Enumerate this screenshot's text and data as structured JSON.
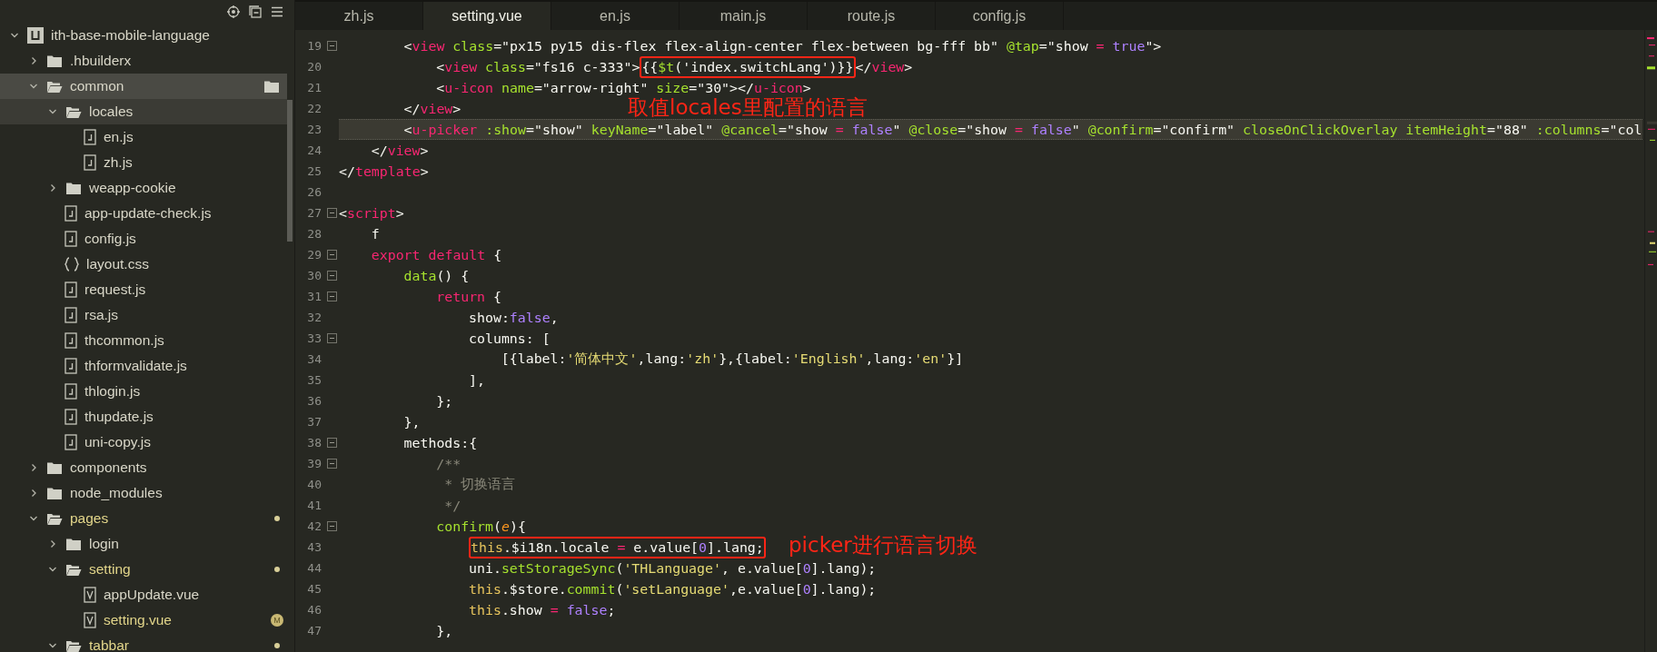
{
  "explorer": {
    "tree": [
      {
        "label": "ith-base-mobile-language",
        "kind": "project",
        "expanded": true,
        "selected": false,
        "hovered": false,
        "modified": false,
        "children": [
          {
            "label": ".hbuilderx",
            "kind": "folder",
            "expanded": false,
            "selected": false,
            "hovered": false,
            "modified": false
          },
          {
            "label": "common",
            "kind": "folder",
            "expanded": true,
            "selected": false,
            "hovered": true,
            "modified": false,
            "children": [
              {
                "label": "locales",
                "kind": "folder",
                "expanded": true,
                "selected": true,
                "hovered": false,
                "modified": false,
                "children": [
                  {
                    "label": "en.js",
                    "kind": "file",
                    "selected": false,
                    "hovered": false,
                    "modified": false
                  },
                  {
                    "label": "zh.js",
                    "kind": "file",
                    "selected": false,
                    "hovered": false,
                    "modified": false
                  }
                ]
              },
              {
                "label": "weapp-cookie",
                "kind": "folder",
                "expanded": false,
                "selected": false,
                "hovered": false,
                "modified": false
              },
              {
                "label": "app-update-check.js",
                "kind": "file",
                "selected": false,
                "hovered": false,
                "modified": false
              },
              {
                "label": "config.js",
                "kind": "file",
                "selected": false,
                "hovered": false,
                "modified": false
              },
              {
                "label": "layout.css",
                "kind": "css",
                "selected": false,
                "hovered": false,
                "modified": false
              },
              {
                "label": "request.js",
                "kind": "file",
                "selected": false,
                "hovered": false,
                "modified": false
              },
              {
                "label": "rsa.js",
                "kind": "file",
                "selected": false,
                "hovered": false,
                "modified": false
              },
              {
                "label": "thcommon.js",
                "kind": "file",
                "selected": false,
                "hovered": false,
                "modified": false
              },
              {
                "label": "thformvalidate.js",
                "kind": "file",
                "selected": false,
                "hovered": false,
                "modified": false
              },
              {
                "label": "thlogin.js",
                "kind": "file",
                "selected": false,
                "hovered": false,
                "modified": false
              },
              {
                "label": "thupdate.js",
                "kind": "file",
                "selected": false,
                "hovered": false,
                "modified": false
              },
              {
                "label": "uni-copy.js",
                "kind": "file",
                "selected": false,
                "hovered": false,
                "modified": false
              }
            ]
          },
          {
            "label": "components",
            "kind": "folder",
            "expanded": false,
            "selected": false,
            "hovered": false,
            "modified": false
          },
          {
            "label": "node_modules",
            "kind": "folder",
            "expanded": false,
            "selected": false,
            "hovered": false,
            "modified": false
          },
          {
            "label": "pages",
            "kind": "folder",
            "expanded": true,
            "selected": false,
            "hovered": false,
            "modified": true,
            "children": [
              {
                "label": "login",
                "kind": "folder",
                "expanded": false,
                "selected": false,
                "hovered": false,
                "modified": false
              },
              {
                "label": "setting",
                "kind": "folder",
                "expanded": true,
                "selected": false,
                "hovered": false,
                "modified": true,
                "children": [
                  {
                    "label": "appUpdate.vue",
                    "kind": "vue",
                    "selected": false,
                    "hovered": false,
                    "modified": false
                  },
                  {
                    "label": "setting.vue",
                    "kind": "vue",
                    "selected": false,
                    "hovered": false,
                    "modified": true,
                    "badge": "M"
                  }
                ]
              },
              {
                "label": "tabbar",
                "kind": "folder",
                "expanded": true,
                "selected": false,
                "hovered": false,
                "modified": true
              }
            ]
          }
        ]
      }
    ]
  },
  "tabs": [
    {
      "label": "zh.js",
      "selected": false
    },
    {
      "label": "setting.vue",
      "selected": true
    },
    {
      "label": "en.js",
      "selected": false
    },
    {
      "label": "main.js",
      "selected": false
    },
    {
      "label": "route.js",
      "selected": false
    },
    {
      "label": "config.js",
      "selected": false
    }
  ],
  "editor": {
    "lines": [
      {
        "number": "19",
        "fold": true,
        "current": false,
        "tokens": [
          {
            "kind": "plain",
            "text": "        <"
          },
          {
            "kind": "tag",
            "text": "view "
          },
          {
            "kind": "attr",
            "text": "class"
          },
          {
            "kind": "plain",
            "text": "=\"px15 py15 dis-flex flex-align-center flex-between bg-fff bb\" "
          },
          {
            "kind": "attr",
            "text": "@tap"
          },
          {
            "kind": "plain",
            "text": "=\"show "
          },
          {
            "kind": "op",
            "text": "="
          },
          {
            "kind": "num",
            "text": " true"
          },
          {
            "kind": "plain",
            "text": "\">"
          }
        ]
      },
      {
        "number": "20",
        "fold": false,
        "current": false,
        "tokens": [
          {
            "kind": "plain",
            "text": "            <"
          },
          {
            "kind": "tag",
            "text": "view "
          },
          {
            "kind": "attr",
            "text": "class"
          },
          {
            "kind": "plain",
            "text": "=\"fs16 c-333\">"
          },
          {
            "kind": "box",
            "tokens": [
              {
                "kind": "plain",
                "text": "{{"
              },
              {
                "kind": "fn",
                "text": "$t"
              },
              {
                "kind": "plain",
                "text": "('index.switchLang')}}"
              }
            ]
          },
          {
            "kind": "plain",
            "text": "</"
          },
          {
            "kind": "tag",
            "text": "view"
          },
          {
            "kind": "plain",
            "text": ">"
          }
        ]
      },
      {
        "number": "21",
        "fold": false,
        "current": false,
        "tokens": [
          {
            "kind": "plain",
            "text": "            <"
          },
          {
            "kind": "tag",
            "text": "u-icon "
          },
          {
            "kind": "attr",
            "text": "name"
          },
          {
            "kind": "plain",
            "text": "=\"arrow-right\" "
          },
          {
            "kind": "attr",
            "text": "size"
          },
          {
            "kind": "plain",
            "text": "=\"30\"></"
          },
          {
            "kind": "tag",
            "text": "u-icon"
          },
          {
            "kind": "plain",
            "text": ">"
          }
        ]
      },
      {
        "number": "22",
        "fold": false,
        "current": false,
        "tokens": [
          {
            "kind": "plain",
            "text": "        </"
          },
          {
            "kind": "tag",
            "text": "view"
          },
          {
            "kind": "plain",
            "text": ">"
          }
        ]
      },
      {
        "number": "23",
        "fold": false,
        "current": true,
        "tokens": [
          {
            "kind": "plain",
            "text": "        <"
          },
          {
            "kind": "tag",
            "text": "u-picker "
          },
          {
            "kind": "attr",
            "text": ":show"
          },
          {
            "kind": "plain",
            "text": "=\"show\" "
          },
          {
            "kind": "attr",
            "text": "keyName"
          },
          {
            "kind": "plain",
            "text": "=\"label\" "
          },
          {
            "kind": "attr",
            "text": "@cancel"
          },
          {
            "kind": "plain",
            "text": "=\"show "
          },
          {
            "kind": "op",
            "text": "="
          },
          {
            "kind": "num",
            "text": " false"
          },
          {
            "kind": "plain",
            "text": "\" "
          },
          {
            "kind": "attr",
            "text": "@close"
          },
          {
            "kind": "plain",
            "text": "=\"show "
          },
          {
            "kind": "op",
            "text": "="
          },
          {
            "kind": "num",
            "text": " false"
          },
          {
            "kind": "plain",
            "text": "\" "
          },
          {
            "kind": "attr",
            "text": "@confirm"
          },
          {
            "kind": "plain",
            "text": "=\"confirm\" "
          },
          {
            "kind": "attr",
            "text": "closeOnClickOverlay itemHeight"
          },
          {
            "kind": "plain",
            "text": "=\"88\" "
          },
          {
            "kind": "attr",
            "text": ":columns"
          },
          {
            "kind": "plain",
            "text": "=\"col"
          }
        ]
      },
      {
        "number": "24",
        "fold": false,
        "current": false,
        "tokens": [
          {
            "kind": "plain",
            "text": "    </"
          },
          {
            "kind": "tag",
            "text": "view"
          },
          {
            "kind": "plain",
            "text": ">"
          }
        ]
      },
      {
        "number": "25",
        "fold": false,
        "current": false,
        "tokens": [
          {
            "kind": "plain",
            "text": "</"
          },
          {
            "kind": "tag",
            "text": "template"
          },
          {
            "kind": "plain",
            "text": ">"
          }
        ]
      },
      {
        "number": "26",
        "fold": false,
        "current": false
      },
      {
        "number": "27",
        "fold": true,
        "current": false,
        "tokens": [
          {
            "kind": "plain",
            "text": "<"
          },
          {
            "kind": "tag",
            "text": "script"
          },
          {
            "kind": "plain",
            "text": ">"
          }
        ]
      },
      {
        "number": "28",
        "fold": false,
        "current": false,
        "tokens": [
          {
            "kind": "plain",
            "text": "    f"
          }
        ]
      },
      {
        "number": "29",
        "fold": true,
        "current": false,
        "tokens": [
          {
            "kind": "kw",
            "text": "    export default"
          },
          {
            "kind": "plain",
            "text": " {"
          }
        ]
      },
      {
        "number": "30",
        "fold": true,
        "current": false,
        "tokens": [
          {
            "kind": "fn",
            "text": "        data"
          },
          {
            "kind": "plain",
            "text": "() {"
          }
        ]
      },
      {
        "number": "31",
        "fold": true,
        "current": false,
        "tokens": [
          {
            "kind": "kw",
            "text": "            return"
          },
          {
            "kind": "plain",
            "text": " {"
          }
        ]
      },
      {
        "number": "32",
        "fold": false,
        "current": false,
        "tokens": [
          {
            "kind": "plain",
            "text": "                show:"
          },
          {
            "kind": "num",
            "text": "false"
          },
          {
            "kind": "plain",
            "text": ","
          }
        ]
      },
      {
        "number": "33",
        "fold": true,
        "current": false,
        "tokens": [
          {
            "kind": "plain",
            "text": "                columns: ["
          }
        ]
      },
      {
        "number": "34",
        "fold": false,
        "current": false,
        "tokens": [
          {
            "kind": "plain",
            "text": "                    [{label:"
          },
          {
            "kind": "str",
            "text": "'简体中文'"
          },
          {
            "kind": "plain",
            "text": ",lang:"
          },
          {
            "kind": "str",
            "text": "'zh'"
          },
          {
            "kind": "plain",
            "text": "},{label:"
          },
          {
            "kind": "str",
            "text": "'English'"
          },
          {
            "kind": "plain",
            "text": ",lang:"
          },
          {
            "kind": "str",
            "text": "'en'"
          },
          {
            "kind": "plain",
            "text": "}]"
          }
        ]
      },
      {
        "number": "35",
        "fold": false,
        "current": false,
        "tokens": [
          {
            "kind": "plain",
            "text": "                ],"
          }
        ]
      },
      {
        "number": "36",
        "fold": false,
        "current": false,
        "tokens": [
          {
            "kind": "plain",
            "text": "            };"
          }
        ]
      },
      {
        "number": "37",
        "fold": false,
        "current": false,
        "tokens": [
          {
            "kind": "plain",
            "text": "        },"
          }
        ]
      },
      {
        "number": "38",
        "fold": true,
        "current": false,
        "tokens": [
          {
            "kind": "plain",
            "text": "        methods:{"
          }
        ]
      },
      {
        "number": "39",
        "fold": true,
        "current": false,
        "tokens": [
          {
            "kind": "comment",
            "text": "            /**"
          }
        ]
      },
      {
        "number": "40",
        "fold": false,
        "current": false,
        "tokens": [
          {
            "kind": "comment",
            "text": "             * 切换语言"
          }
        ]
      },
      {
        "number": "41",
        "fold": false,
        "current": false,
        "tokens": [
          {
            "kind": "comment",
            "text": "             */"
          }
        ]
      },
      {
        "number": "42",
        "fold": true,
        "current": false,
        "tokens": [
          {
            "kind": "fn",
            "text": "            confirm"
          },
          {
            "kind": "plain",
            "text": "("
          },
          {
            "kind": "param",
            "text": "e"
          },
          {
            "kind": "plain",
            "text": "){"
          }
        ]
      },
      {
        "number": "43",
        "fold": false,
        "current": false,
        "tokens": [
          {
            "kind": "box",
            "tokens": [
              {
                "kind": "this",
                "text": "                this"
              },
              {
                "kind": "plain",
                "text": ".$i18n.locale "
              },
              {
                "kind": "op",
                "text": "="
              },
              {
                "kind": "plain",
                "text": " e.value["
              },
              {
                "kind": "num",
                "text": "0"
              },
              {
                "kind": "plain",
                "text": "].lang;"
              }
            ]
          }
        ]
      },
      {
        "number": "44",
        "fold": false,
        "current": false,
        "tokens": [
          {
            "kind": "plain",
            "text": "                uni."
          },
          {
            "kind": "fn",
            "text": "setStorageSync"
          },
          {
            "kind": "plain",
            "text": "("
          },
          {
            "kind": "str",
            "text": "'THLanguage'"
          },
          {
            "kind": "plain",
            "text": ", e.value["
          },
          {
            "kind": "num",
            "text": "0"
          },
          {
            "kind": "plain",
            "text": "].lang);"
          }
        ]
      },
      {
        "number": "45",
        "fold": false,
        "current": false,
        "tokens": [
          {
            "kind": "this",
            "text": "                this"
          },
          {
            "kind": "plain",
            "text": ".$store."
          },
          {
            "kind": "fn",
            "text": "commit"
          },
          {
            "kind": "plain",
            "text": "("
          },
          {
            "kind": "str",
            "text": "'setLanguage'"
          },
          {
            "kind": "plain",
            "text": ",e.value["
          },
          {
            "kind": "num",
            "text": "0"
          },
          {
            "kind": "plain",
            "text": "].lang);"
          }
        ]
      },
      {
        "number": "46",
        "fold": false,
        "current": false,
        "tokens": [
          {
            "kind": "this",
            "text": "                this"
          },
          {
            "kind": "plain",
            "text": ".show "
          },
          {
            "kind": "op",
            "text": "="
          },
          {
            "kind": "num",
            "text": " false"
          },
          {
            "kind": "plain",
            "text": ";"
          }
        ]
      },
      {
        "number": "47",
        "fold": false,
        "current": false,
        "tokens": [
          {
            "kind": "plain",
            "text": "            },"
          }
        ]
      }
    ]
  },
  "annotations": [
    {
      "text": "取值locales里配置的语言"
    },
    {
      "text": "picker进行语言切换"
    }
  ]
}
